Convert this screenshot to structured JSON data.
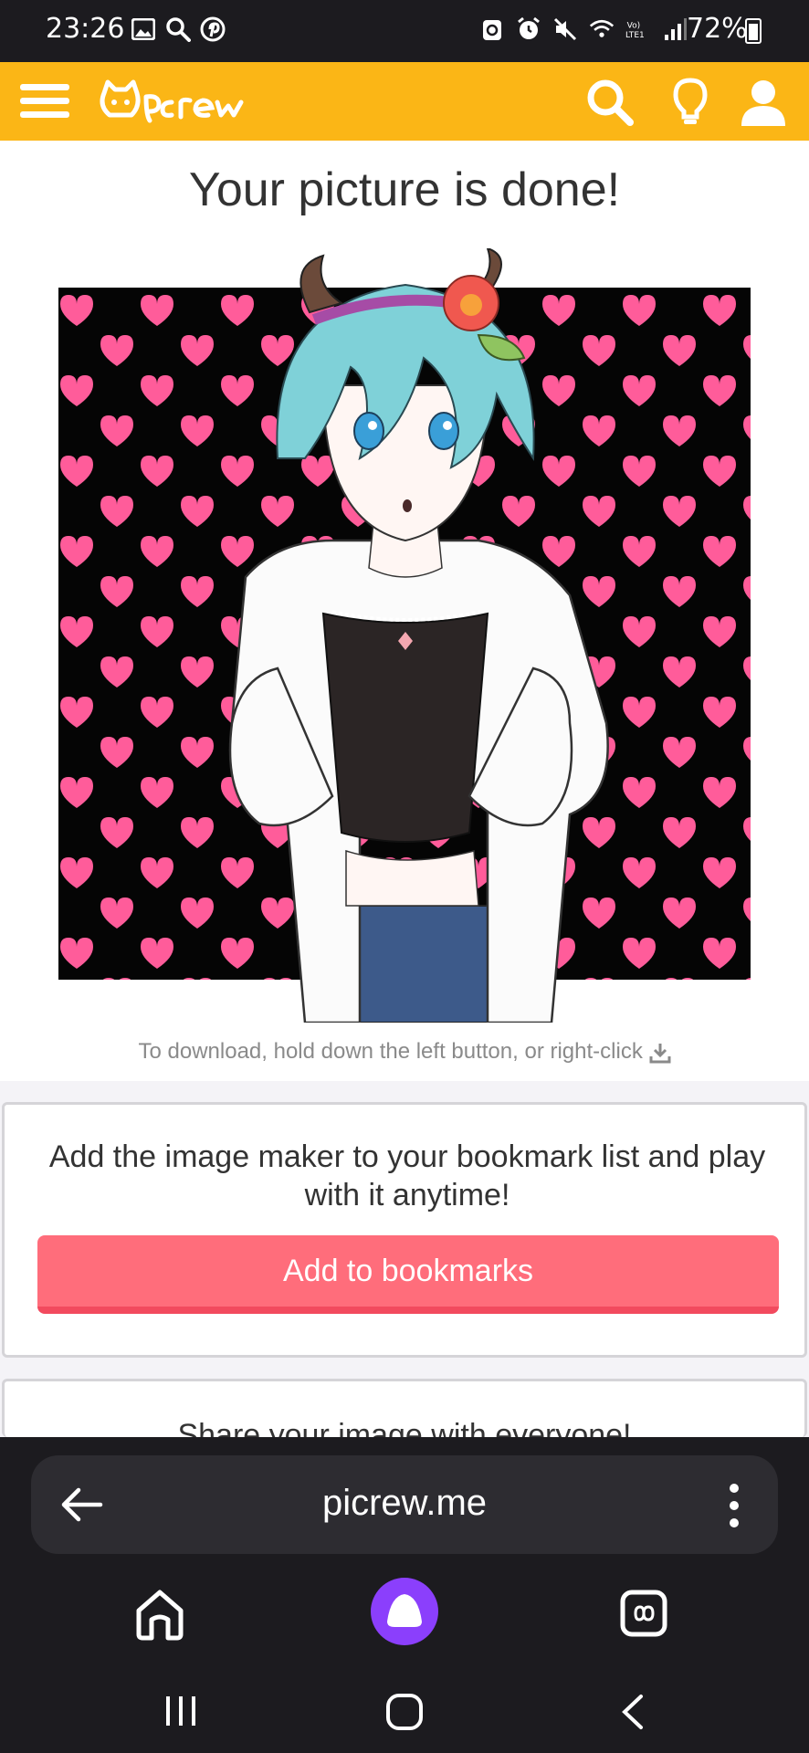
{
  "status_bar": {
    "time": "23:26",
    "battery": "72%",
    "left_icons": [
      "gallery-icon",
      "search-icon",
      "pinterest-icon"
    ],
    "right_icons": [
      "recycle-icon",
      "alarm-icon",
      "mute-icon",
      "wifi-icon",
      "volte-icon",
      "signal-icon",
      "battery-icon"
    ]
  },
  "header": {
    "brand_color": "#fbb616",
    "logo_text": "Picrew",
    "icons": [
      "menu-icon",
      "search-icon",
      "lightbulb-icon",
      "user-icon"
    ]
  },
  "main": {
    "title": "Your picture is done!",
    "download_hint": "To download, hold down the left button, or right-click",
    "download_icon": "download-icon"
  },
  "bookmark_card": {
    "text": "Add the image maker to your bookmark list and play with it anytime!",
    "button_label": "Add to bookmarks",
    "button_color": "#ff6d7b"
  },
  "share_card": {
    "text": "Share your image with everyone!"
  },
  "browser": {
    "url": "picrew.me",
    "icons": [
      "back-arrow-icon",
      "more-vert-icon",
      "home-icon",
      "alice-assistant-icon",
      "tabs-icon"
    ],
    "assistant_color": "#8b3ffc"
  },
  "system_nav": {
    "icons": [
      "recents-icon",
      "home-circle-icon",
      "back-chevron-icon"
    ]
  }
}
